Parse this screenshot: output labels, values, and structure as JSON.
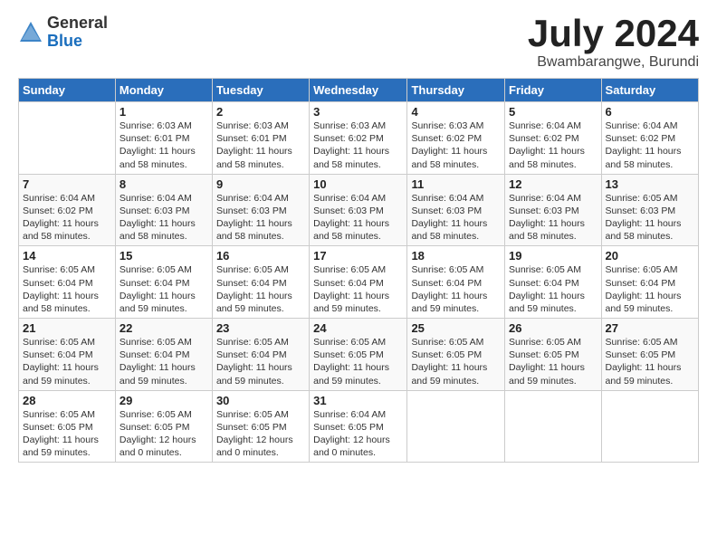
{
  "logo": {
    "general": "General",
    "blue": "Blue"
  },
  "title": {
    "month": "July 2024",
    "location": "Bwambarangwe, Burundi"
  },
  "headers": [
    "Sunday",
    "Monday",
    "Tuesday",
    "Wednesday",
    "Thursday",
    "Friday",
    "Saturday"
  ],
  "weeks": [
    [
      {
        "day": "",
        "sunrise": "",
        "sunset": "",
        "daylight": ""
      },
      {
        "day": "1",
        "sunrise": "Sunrise: 6:03 AM",
        "sunset": "Sunset: 6:01 PM",
        "daylight": "Daylight: 11 hours and 58 minutes."
      },
      {
        "day": "2",
        "sunrise": "Sunrise: 6:03 AM",
        "sunset": "Sunset: 6:01 PM",
        "daylight": "Daylight: 11 hours and 58 minutes."
      },
      {
        "day": "3",
        "sunrise": "Sunrise: 6:03 AM",
        "sunset": "Sunset: 6:02 PM",
        "daylight": "Daylight: 11 hours and 58 minutes."
      },
      {
        "day": "4",
        "sunrise": "Sunrise: 6:03 AM",
        "sunset": "Sunset: 6:02 PM",
        "daylight": "Daylight: 11 hours and 58 minutes."
      },
      {
        "day": "5",
        "sunrise": "Sunrise: 6:04 AM",
        "sunset": "Sunset: 6:02 PM",
        "daylight": "Daylight: 11 hours and 58 minutes."
      },
      {
        "day": "6",
        "sunrise": "Sunrise: 6:04 AM",
        "sunset": "Sunset: 6:02 PM",
        "daylight": "Daylight: 11 hours and 58 minutes."
      }
    ],
    [
      {
        "day": "7",
        "sunrise": "Sunrise: 6:04 AM",
        "sunset": "Sunset: 6:02 PM",
        "daylight": "Daylight: 11 hours and 58 minutes."
      },
      {
        "day": "8",
        "sunrise": "Sunrise: 6:04 AM",
        "sunset": "Sunset: 6:03 PM",
        "daylight": "Daylight: 11 hours and 58 minutes."
      },
      {
        "day": "9",
        "sunrise": "Sunrise: 6:04 AM",
        "sunset": "Sunset: 6:03 PM",
        "daylight": "Daylight: 11 hours and 58 minutes."
      },
      {
        "day": "10",
        "sunrise": "Sunrise: 6:04 AM",
        "sunset": "Sunset: 6:03 PM",
        "daylight": "Daylight: 11 hours and 58 minutes."
      },
      {
        "day": "11",
        "sunrise": "Sunrise: 6:04 AM",
        "sunset": "Sunset: 6:03 PM",
        "daylight": "Daylight: 11 hours and 58 minutes."
      },
      {
        "day": "12",
        "sunrise": "Sunrise: 6:04 AM",
        "sunset": "Sunset: 6:03 PM",
        "daylight": "Daylight: 11 hours and 58 minutes."
      },
      {
        "day": "13",
        "sunrise": "Sunrise: 6:05 AM",
        "sunset": "Sunset: 6:03 PM",
        "daylight": "Daylight: 11 hours and 58 minutes."
      }
    ],
    [
      {
        "day": "14",
        "sunrise": "Sunrise: 6:05 AM",
        "sunset": "Sunset: 6:04 PM",
        "daylight": "Daylight: 11 hours and 58 minutes."
      },
      {
        "day": "15",
        "sunrise": "Sunrise: 6:05 AM",
        "sunset": "Sunset: 6:04 PM",
        "daylight": "Daylight: 11 hours and 59 minutes."
      },
      {
        "day": "16",
        "sunrise": "Sunrise: 6:05 AM",
        "sunset": "Sunset: 6:04 PM",
        "daylight": "Daylight: 11 hours and 59 minutes."
      },
      {
        "day": "17",
        "sunrise": "Sunrise: 6:05 AM",
        "sunset": "Sunset: 6:04 PM",
        "daylight": "Daylight: 11 hours and 59 minutes."
      },
      {
        "day": "18",
        "sunrise": "Sunrise: 6:05 AM",
        "sunset": "Sunset: 6:04 PM",
        "daylight": "Daylight: 11 hours and 59 minutes."
      },
      {
        "day": "19",
        "sunrise": "Sunrise: 6:05 AM",
        "sunset": "Sunset: 6:04 PM",
        "daylight": "Daylight: 11 hours and 59 minutes."
      },
      {
        "day": "20",
        "sunrise": "Sunrise: 6:05 AM",
        "sunset": "Sunset: 6:04 PM",
        "daylight": "Daylight: 11 hours and 59 minutes."
      }
    ],
    [
      {
        "day": "21",
        "sunrise": "Sunrise: 6:05 AM",
        "sunset": "Sunset: 6:04 PM",
        "daylight": "Daylight: 11 hours and 59 minutes."
      },
      {
        "day": "22",
        "sunrise": "Sunrise: 6:05 AM",
        "sunset": "Sunset: 6:04 PM",
        "daylight": "Daylight: 11 hours and 59 minutes."
      },
      {
        "day": "23",
        "sunrise": "Sunrise: 6:05 AM",
        "sunset": "Sunset: 6:04 PM",
        "daylight": "Daylight: 11 hours and 59 minutes."
      },
      {
        "day": "24",
        "sunrise": "Sunrise: 6:05 AM",
        "sunset": "Sunset: 6:05 PM",
        "daylight": "Daylight: 11 hours and 59 minutes."
      },
      {
        "day": "25",
        "sunrise": "Sunrise: 6:05 AM",
        "sunset": "Sunset: 6:05 PM",
        "daylight": "Daylight: 11 hours and 59 minutes."
      },
      {
        "day": "26",
        "sunrise": "Sunrise: 6:05 AM",
        "sunset": "Sunset: 6:05 PM",
        "daylight": "Daylight: 11 hours and 59 minutes."
      },
      {
        "day": "27",
        "sunrise": "Sunrise: 6:05 AM",
        "sunset": "Sunset: 6:05 PM",
        "daylight": "Daylight: 11 hours and 59 minutes."
      }
    ],
    [
      {
        "day": "28",
        "sunrise": "Sunrise: 6:05 AM",
        "sunset": "Sunset: 6:05 PM",
        "daylight": "Daylight: 11 hours and 59 minutes."
      },
      {
        "day": "29",
        "sunrise": "Sunrise: 6:05 AM",
        "sunset": "Sunset: 6:05 PM",
        "daylight": "Daylight: 12 hours and 0 minutes."
      },
      {
        "day": "30",
        "sunrise": "Sunrise: 6:05 AM",
        "sunset": "Sunset: 6:05 PM",
        "daylight": "Daylight: 12 hours and 0 minutes."
      },
      {
        "day": "31",
        "sunrise": "Sunrise: 6:04 AM",
        "sunset": "Sunset: 6:05 PM",
        "daylight": "Daylight: 12 hours and 0 minutes."
      },
      {
        "day": "",
        "sunrise": "",
        "sunset": "",
        "daylight": ""
      },
      {
        "day": "",
        "sunrise": "",
        "sunset": "",
        "daylight": ""
      },
      {
        "day": "",
        "sunrise": "",
        "sunset": "",
        "daylight": ""
      }
    ]
  ]
}
